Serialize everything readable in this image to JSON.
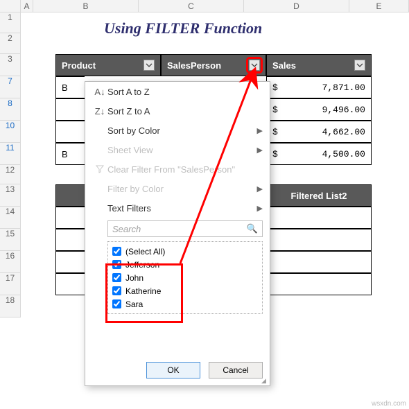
{
  "columns": [
    "A",
    "B",
    "C",
    "D",
    "E"
  ],
  "rows": [
    "1",
    "2",
    "3",
    "7",
    "8",
    "10",
    "11",
    "12",
    "13",
    "14",
    "15",
    "16",
    "17",
    "18"
  ],
  "title": "Using FILTER Function",
  "headers": {
    "product": "Product",
    "salesperson": "SalesPerson",
    "sales": "Sales",
    "filtered2": "Filtered List2"
  },
  "table": {
    "rows": [
      {
        "product": "B",
        "sales_sym": "$",
        "sales_val": "7,871.00"
      },
      {
        "product": "",
        "sales_sym": "$",
        "sales_val": "9,496.00"
      },
      {
        "product": "",
        "sales_sym": "$",
        "sales_val": "4,662.00"
      },
      {
        "product": "B",
        "sales_sym": "$",
        "sales_val": "4,500.00"
      }
    ]
  },
  "dropdown": {
    "sort_az": "Sort A to Z",
    "sort_za": "Sort Z to A",
    "sort_color": "Sort by Color",
    "sheet_view": "Sheet View",
    "clear": "Clear Filter From \"SalesPerson\"",
    "filter_color": "Filter by Color",
    "text_filters": "Text Filters",
    "search_placeholder": "Search",
    "options": [
      "(Select All)",
      "Jefferson",
      "John",
      "Katherine",
      "Sara"
    ],
    "ok": "OK",
    "cancel": "Cancel"
  },
  "watermark": "wsxdn.com",
  "chart_data": {
    "type": "table",
    "title": "Using FILTER Function",
    "columns": [
      "Product",
      "SalesPerson",
      "Sales"
    ],
    "rows": [
      [
        "B",
        null,
        7871.0
      ],
      [
        null,
        null,
        9496.0
      ],
      [
        null,
        null,
        4662.0
      ],
      [
        "B",
        null,
        4500.0
      ]
    ],
    "filter": {
      "column": "SalesPerson",
      "values": [
        "Jefferson",
        "John",
        "Katherine",
        "Sara"
      ],
      "select_all": true
    }
  }
}
